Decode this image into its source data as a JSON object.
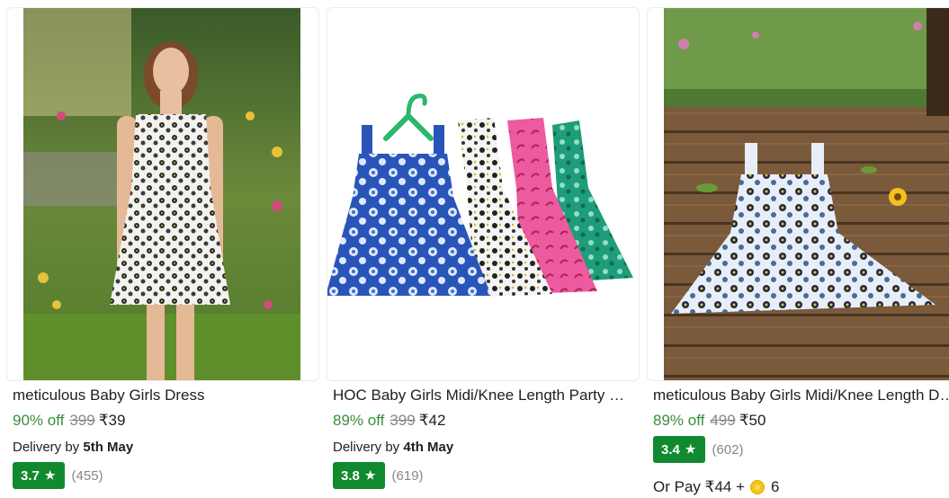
{
  "products": [
    {
      "title": "meticulous Baby Girls Dress",
      "discount": "90% off",
      "mrp": "399",
      "price": "₹39",
      "delivery_prefix": "Delivery by",
      "delivery_date": "5th May",
      "rating": "3.7",
      "rating_count": "(455)",
      "image_icon": "woman-in-floral-dress-photo"
    },
    {
      "title": "HOC Baby Girls Midi/Knee Length Party Dress",
      "discount": "89% off",
      "mrp": "399",
      "price": "₹42",
      "delivery_prefix": "Delivery by",
      "delivery_date": "4th May",
      "rating": "3.8",
      "rating_count": "(619)",
      "image_icon": "four-girls-dresses-photo"
    },
    {
      "title": "meticulous Baby Girls Midi/Knee Length Dress",
      "discount": "89% off",
      "mrp": "499",
      "price": "₹50",
      "rating": "3.4",
      "rating_count": "(602)",
      "or_pay_prefix": "Or Pay",
      "or_pay_amount": "₹44",
      "or_pay_plus": "+",
      "or_pay_coins": "6",
      "image_icon": "dress-on-wooden-deck-photo"
    }
  ],
  "colors": {
    "discount_green": "#388e3c",
    "rating_badge": "#118a2f",
    "muted_gray": "#878787"
  }
}
